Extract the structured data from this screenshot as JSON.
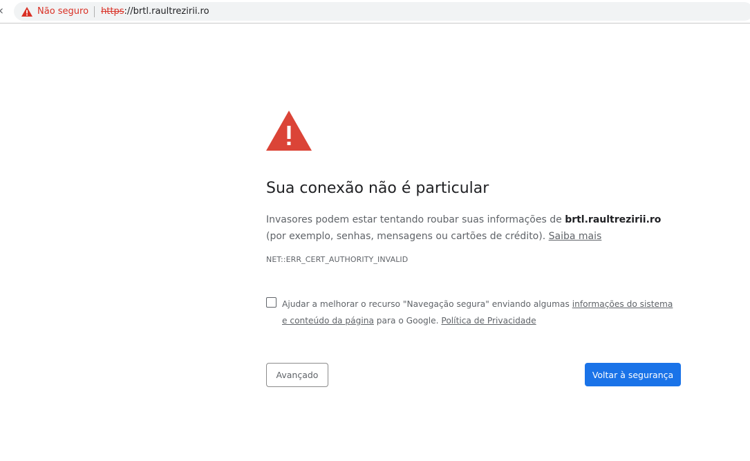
{
  "omnibox": {
    "security_label": "Não seguro",
    "url_scheme": "https",
    "url_rest": "://brtl.raultrezirii.ro",
    "icon": "warning-triangle-icon"
  },
  "interstitial": {
    "icon": "warning-triangle-icon",
    "heading": "Sua conexão não é particular",
    "paragraph_before": "Invasores podem estar tentando roubar suas informações de ",
    "paragraph_host": "brtl.raultrezirii.ro",
    "paragraph_after": " (por exemplo, senhas, mensagens ou cartões de crédito). ",
    "learn_more": "Saiba mais",
    "error_code": "NET::ERR_CERT_AUTHORITY_INVALID",
    "checkbox": {
      "checked": false,
      "text_before": "Ajudar a melhorar o recurso \"Navegação segura\" enviando algumas ",
      "link_system": "informações do sistema e conteúdo da página",
      "text_mid": " para o Google. ",
      "link_privacy": "Política de Privacidade"
    },
    "advanced_button": "Avançado",
    "back_button": "Voltar à segurança"
  },
  "colors": {
    "warning_red": "#d93025",
    "warning_icon_red": "#db4437",
    "primary_blue": "#1a73e8"
  }
}
